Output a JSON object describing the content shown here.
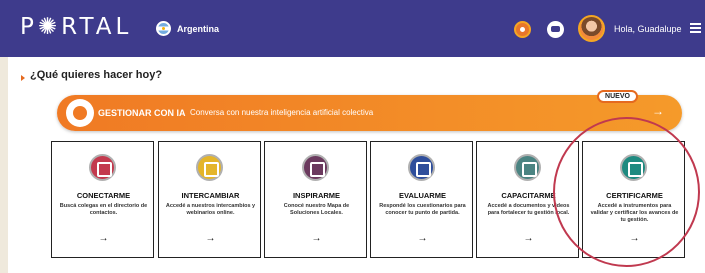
{
  "header": {
    "logo": "P✺RTAL",
    "country": "Argentina",
    "greeting": "Hola, Guadalupe"
  },
  "main": {
    "question": "¿Qué quieres hacer hoy?",
    "ia_banner": {
      "title": "GESTIONAR CON IA",
      "subtitle": "Conversa con nuestra inteligencia artificial colectiva",
      "badge": "NUEVO",
      "arrow": "→"
    },
    "cards": [
      {
        "title": "CONECTARME",
        "description": "Buscá colegas en el directorio de contactos.",
        "arrow": "→",
        "color": "#c33a4e"
      },
      {
        "title": "INTERCAMBIAR",
        "description": "Accedé a nuestros intercambios y webinarios online.",
        "arrow": "→",
        "color": "#e4b52a"
      },
      {
        "title": "INSPIRARME",
        "description": "Conocé nuestro Mapa de Soluciones Locales.",
        "arrow": "→",
        "color": "#6b3a5e"
      },
      {
        "title": "EVALUARME",
        "description": "Respondé los cuestionarios para conocer tu punto de partida.",
        "arrow": "→",
        "color": "#2f4e9b"
      },
      {
        "title": "CAPACITARME",
        "description": "Accedé a documentos y videos para fortalecer tu gestión local.",
        "arrow": "→",
        "color": "#4b8482"
      },
      {
        "title": "CERTIFICARME",
        "description": "Accedé a instrumentos para validar y certificar los avances de tu gestión.",
        "arrow": "→",
        "color": "#1f8a80"
      }
    ]
  },
  "colors": {
    "header_bg": "#3e3b8c",
    "accent": "#f07a24",
    "highlight": "#c0394f"
  }
}
